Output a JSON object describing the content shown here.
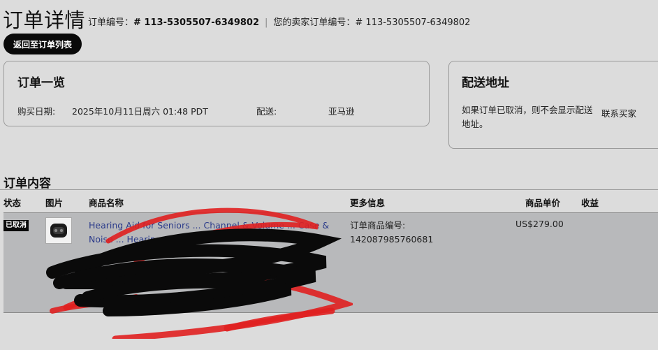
{
  "header": {
    "title": "订单详情",
    "order_no_label": "订单编号：",
    "order_no_value": "# 113-5305507-6349802",
    "seller_order_no_label": "您的卖家订单编号：",
    "seller_order_no_value": "# 113-5305507-6349802",
    "separator": "|",
    "back_button": "返回至订单列表"
  },
  "summary": {
    "title": "订单一览",
    "purchase_date_label": "购买日期:",
    "purchase_date_value": "2025年10月11日周六 01:48 PDT",
    "shipping_label": "配送:",
    "shipping_value": "亚马逊"
  },
  "shipping_address": {
    "title": "配送地址",
    "note": "如果订单已取消，则不会显示配送地址。",
    "contact_buyer": "联系买家"
  },
  "order_content": {
    "title": "订单内容",
    "columns": [
      "状态",
      "图片",
      "商品名称",
      "更多信息",
      "商品单价",
      "收益"
    ],
    "items": [
      {
        "status": "已取消",
        "product_name_visible": "Hearing Aid for Seniors ... Channel & Volume ... Case & Noise ... Hearing Loss",
        "more_info_label": "订单商品编号:",
        "more_info_value": "142087985760681",
        "unit_price": "US$279.00",
        "earnings": ""
      }
    ]
  },
  "colors": {
    "background": "#dcdcdc",
    "row_highlight": "#b8b9bb",
    "scribble_black": "#0a0a0a",
    "scribble_red": "#e02020",
    "link": "#2a3a8a"
  }
}
